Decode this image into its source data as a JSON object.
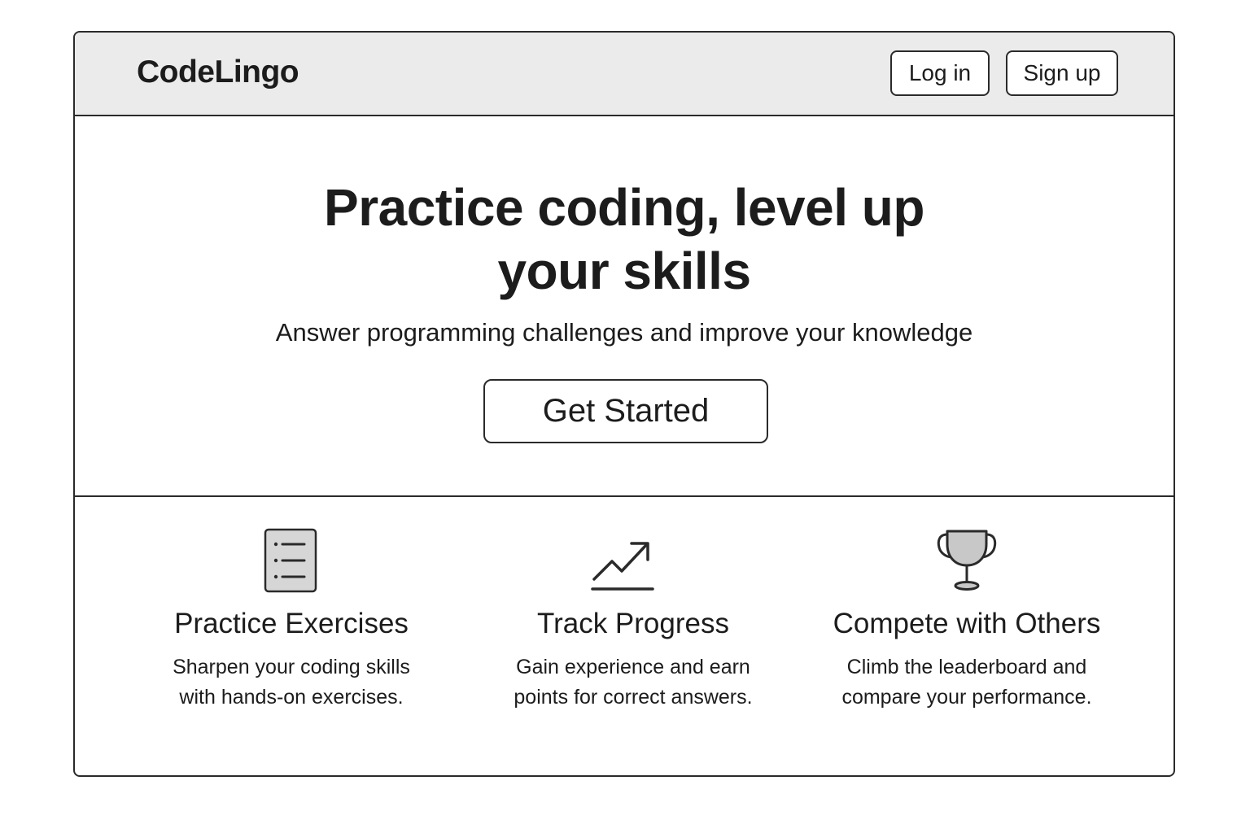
{
  "header": {
    "logo": "CodeLingo",
    "login_label": "Log in",
    "signup_label": "Sign up"
  },
  "hero": {
    "title_line1": "Practice coding, level up",
    "title_line2": "your skills",
    "subtitle": "Answer programming challenges and improve your knowledge",
    "cta_label": "Get Started"
  },
  "features": [
    {
      "icon": "checklist-icon",
      "title": "Practice Exercises",
      "desc_line1": "Sharpen your coding skills",
      "desc_line2": "with hands-on exercises."
    },
    {
      "icon": "trending-up-icon",
      "title": "Track Progress",
      "desc_line1": "Gain experience and earn",
      "desc_line2": "points for correct answers."
    },
    {
      "icon": "trophy-icon",
      "title": "Compete with Others",
      "desc_line1": "Climb the leaderboard and",
      "desc_line2": "compare your performance."
    }
  ],
  "colors": {
    "border": "#2a2a2a",
    "header_bg": "#ebebeb",
    "icon_fill": "#c8c8c8",
    "text": "#1c1c1c"
  }
}
